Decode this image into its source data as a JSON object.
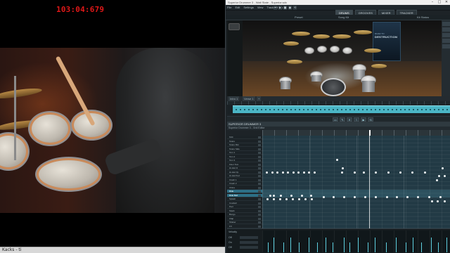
{
  "video": {
    "timecode": "103:04:679"
  },
  "taskbar": {
    "label": "Kacks - ti"
  },
  "app": {
    "title": "Superior Drummer 3 - Wait State - Superior.sdx",
    "window_buttons": [
      "–",
      "□",
      "✕"
    ],
    "menu": [
      "File",
      "Edit",
      "Settings",
      "View",
      "Track",
      "Help"
    ],
    "transport": [
      "⏮",
      "▶",
      "■",
      "●",
      "⟲"
    ],
    "tabs": [
      {
        "label": "DRUMS",
        "active": true
      },
      {
        "label": "GROOVES",
        "active": false
      },
      {
        "label": "MIXER",
        "active": false
      },
      {
        "label": "TRACKER",
        "active": false
      }
    ],
    "ctrl_labels": [
      "Preset",
      "Song Kit",
      "Kit Status"
    ],
    "kit_poster": {
      "line1": "ROAD TO",
      "line2": "DESTRUCTION"
    },
    "song_tabs": [
      "Intro 1",
      "Verse 1",
      "+"
    ],
    "editor_title": "SUPERIOR DRUMMER 3",
    "editor_sub": "Superior Drummer 3 - Grid Editor",
    "vel_labels": [
      "Velocity",
      "Off",
      "On",
      "Off"
    ],
    "lanes": [
      "Kick",
      "Snare",
      "Snare Rim",
      "Snare Side",
      "Tom 1",
      "Tom 2",
      "Tom 3",
      "Floor Tom",
      "Hi-Hat Cl",
      "Hi-Hat Op",
      "Hi-Hat Ped",
      "Crash 1",
      "Crash 2",
      "China",
      "Ride",
      "Ride Bell",
      "Splash",
      "Cowbell",
      "Perc",
      "Stack",
      "Bongo",
      "Clap",
      "Shaker",
      "FX"
    ],
    "highlight_lanes": [
      14,
      15
    ]
  }
}
